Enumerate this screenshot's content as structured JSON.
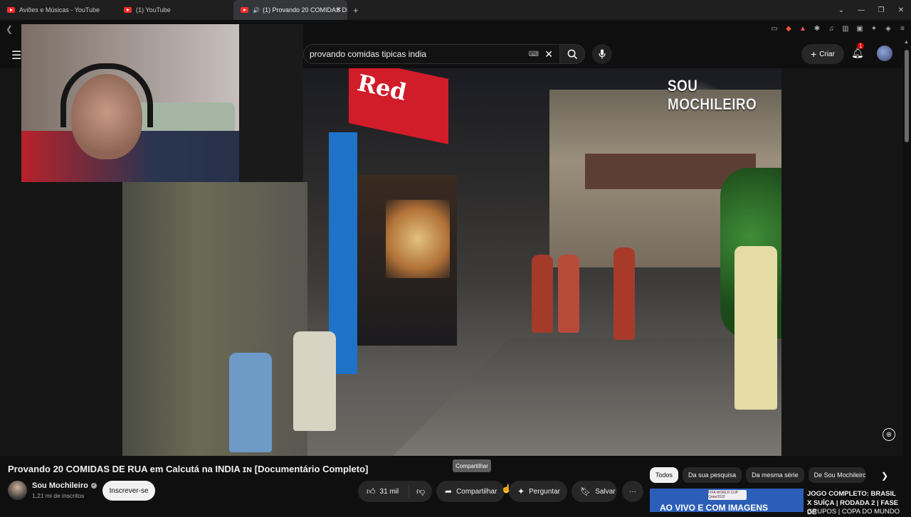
{
  "browser": {
    "tabs": [
      {
        "label": "Aviões e Músicas - YouTube"
      },
      {
        "label": "(1) YouTube"
      },
      {
        "label": "(1) Provando 20 COMIDAS DE"
      }
    ],
    "new_tab": "+",
    "window_controls": [
      "⌄",
      "—",
      "❐",
      "✕"
    ]
  },
  "masthead": {
    "search_query": "provando comidas tipicas india",
    "create_label": "Criar",
    "notification_count": "1"
  },
  "video": {
    "watermark": "SOU MOCHILEIRO",
    "sign_text": "Red"
  },
  "details": {
    "title": "Provando 20 COMIDAS DE RUA em Calcutá na INDIA ɪɴ [Documentário Completo]",
    "channel_name": "Sou Mochileiro",
    "subscribers": "1,21 mi de inscritos",
    "subscribe_label": "Inscrever-se",
    "like_count": "31 mil",
    "share_label": "Compartilhar",
    "ask_label": "Perguntar",
    "save_label": "Salvar",
    "more_label": "···",
    "tooltip": "Compartilhar"
  },
  "chips": [
    {
      "label": "Todos",
      "active": true
    },
    {
      "label": "Da sua pesquisa"
    },
    {
      "label": "Da mesma série"
    },
    {
      "label": "De Sou Mochileiro"
    }
  ],
  "recommendation": {
    "thumb_logo": "FIFA WORLD CUP Qatar2022",
    "thumb_banner": "AO VIVO E COM IMAGENS",
    "title": "JOGO COMPLETO: BRASIL X SUÍÇA | RODADA 2 | FASE DE",
    "subtitle": "GRUPOS | COPA DO MUNDO"
  },
  "colors": {
    "background": "#0f0f0f",
    "youtube_red": "#ff0000",
    "chip_bg": "#272727",
    "text_primary": "#f1f1f1",
    "text_secondary": "#aaaaaa"
  }
}
